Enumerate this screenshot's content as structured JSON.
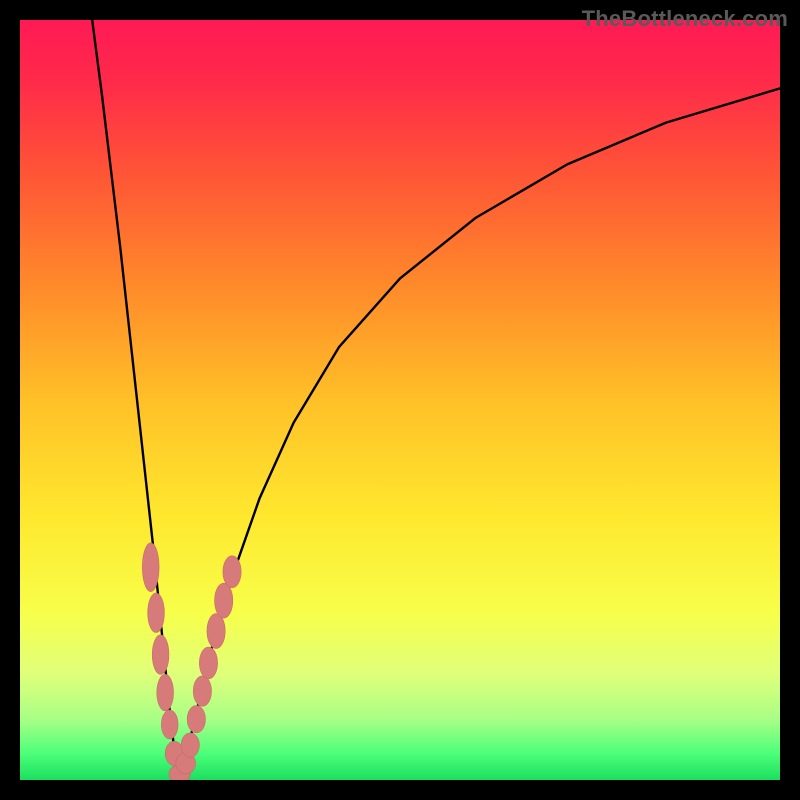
{
  "watermark": "TheBottleneck.com",
  "colors": {
    "frame": "#000000",
    "curve": "#000000",
    "marker_fill": "#d67b7a",
    "marker_stroke": "#c96a69",
    "gradient_stops": [
      {
        "offset": 0.0,
        "color": "#ff1a55"
      },
      {
        "offset": 0.08,
        "color": "#ff2a4a"
      },
      {
        "offset": 0.2,
        "color": "#ff5436"
      },
      {
        "offset": 0.35,
        "color": "#ff8a2a"
      },
      {
        "offset": 0.5,
        "color": "#ffc028"
      },
      {
        "offset": 0.65,
        "color": "#ffe72e"
      },
      {
        "offset": 0.78,
        "color": "#f7ff4a"
      },
      {
        "offset": 0.86,
        "color": "#e0ff7a"
      },
      {
        "offset": 0.92,
        "color": "#a8ff86"
      },
      {
        "offset": 0.965,
        "color": "#4dff7a"
      },
      {
        "offset": 1.0,
        "color": "#1bdf5e"
      }
    ]
  },
  "chart_data": {
    "type": "line",
    "title": "",
    "xlabel": "",
    "ylabel": "",
    "xlim": [
      0,
      100
    ],
    "ylim": [
      0,
      100
    ],
    "curve": {
      "vertex_x": 21,
      "left_points": [
        {
          "x": 9.5,
          "y": 100.0
        },
        {
          "x": 10.8,
          "y": 90.0
        },
        {
          "x": 12.0,
          "y": 80.0
        },
        {
          "x": 13.2,
          "y": 70.0
        },
        {
          "x": 14.3,
          "y": 60.0
        },
        {
          "x": 15.4,
          "y": 50.0
        },
        {
          "x": 16.5,
          "y": 40.0
        },
        {
          "x": 17.6,
          "y": 30.0
        },
        {
          "x": 18.6,
          "y": 20.0
        },
        {
          "x": 19.6,
          "y": 10.0
        },
        {
          "x": 20.3,
          "y": 4.0
        },
        {
          "x": 21.0,
          "y": 0.0
        }
      ],
      "right_points": [
        {
          "x": 21.0,
          "y": 0.0
        },
        {
          "x": 22.3,
          "y": 5.0
        },
        {
          "x": 23.7,
          "y": 11.0
        },
        {
          "x": 25.4,
          "y": 18.0
        },
        {
          "x": 28.0,
          "y": 27.0
        },
        {
          "x": 31.5,
          "y": 37.0
        },
        {
          "x": 36.0,
          "y": 47.0
        },
        {
          "x": 42.0,
          "y": 57.0
        },
        {
          "x": 50.0,
          "y": 66.0
        },
        {
          "x": 60.0,
          "y": 74.0
        },
        {
          "x": 72.0,
          "y": 81.0
        },
        {
          "x": 85.0,
          "y": 86.5
        },
        {
          "x": 100.0,
          "y": 91.0
        }
      ]
    },
    "markers": [
      {
        "x": 17.2,
        "y": 28.0,
        "rx": 1.1,
        "ry": 3.2
      },
      {
        "x": 17.9,
        "y": 22.0,
        "rx": 1.1,
        "ry": 2.6
      },
      {
        "x": 18.5,
        "y": 16.5,
        "rx": 1.1,
        "ry": 2.6
      },
      {
        "x": 19.1,
        "y": 11.5,
        "rx": 1.1,
        "ry": 2.4
      },
      {
        "x": 19.7,
        "y": 7.3,
        "rx": 1.1,
        "ry": 1.9
      },
      {
        "x": 20.3,
        "y": 3.5,
        "rx": 1.2,
        "ry": 1.6
      },
      {
        "x": 21.0,
        "y": 0.8,
        "rx": 1.4,
        "ry": 1.2
      },
      {
        "x": 21.8,
        "y": 2.2,
        "rx": 1.3,
        "ry": 1.4
      },
      {
        "x": 22.4,
        "y": 4.6,
        "rx": 1.2,
        "ry": 1.6
      },
      {
        "x": 23.2,
        "y": 8.0,
        "rx": 1.2,
        "ry": 1.8
      },
      {
        "x": 24.0,
        "y": 11.7,
        "rx": 1.2,
        "ry": 2.0
      },
      {
        "x": 24.8,
        "y": 15.4,
        "rx": 1.2,
        "ry": 2.1
      },
      {
        "x": 25.8,
        "y": 19.6,
        "rx": 1.2,
        "ry": 2.3
      },
      {
        "x": 26.8,
        "y": 23.6,
        "rx": 1.2,
        "ry": 2.3
      },
      {
        "x": 27.9,
        "y": 27.4,
        "rx": 1.2,
        "ry": 2.1
      }
    ]
  }
}
